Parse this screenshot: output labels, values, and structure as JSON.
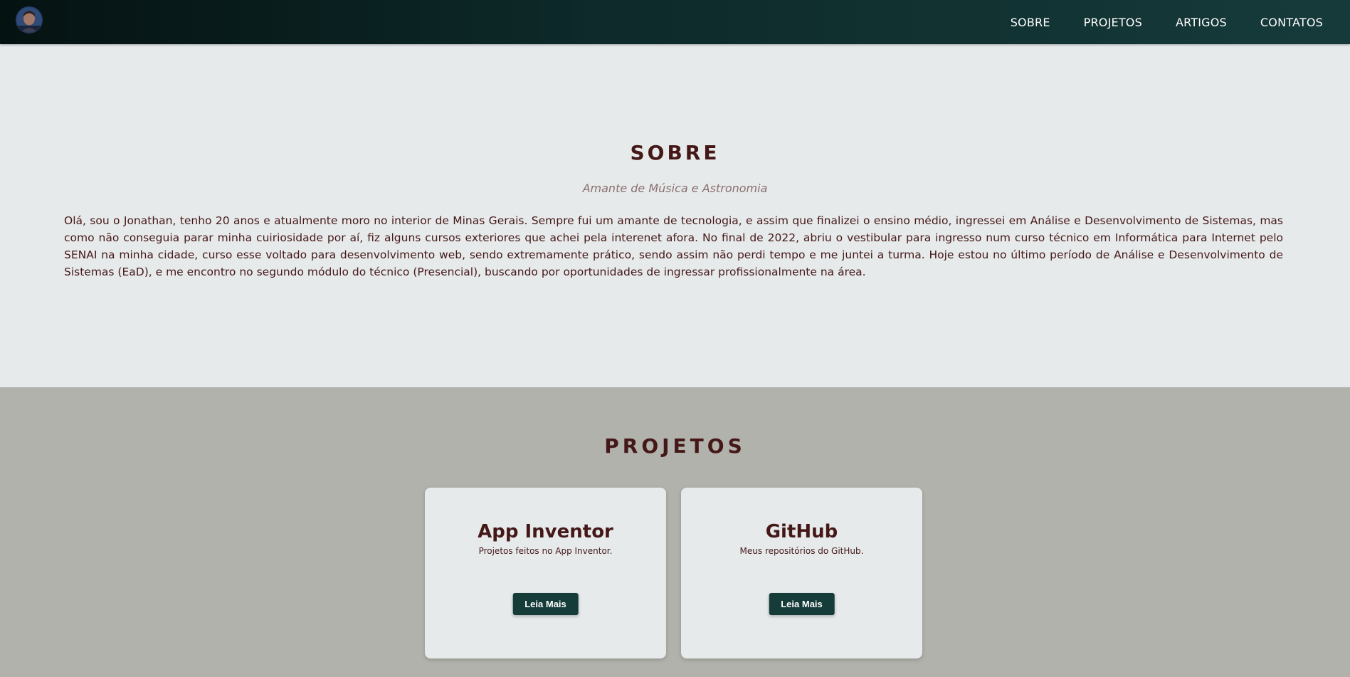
{
  "header": {
    "nav": [
      "SOBRE",
      "PROJETOS",
      "ARTIGOS",
      "CONTATOS"
    ]
  },
  "about": {
    "title": "SOBRE",
    "subtitle": "Amante de Música e Astronomia",
    "text": "Olá, sou o Jonathan, tenho 20 anos e atualmente moro no interior de Minas Gerais. Sempre fui um amante de tecnologia, e assim que finalizei o ensino médio, ingressei em Análise e Desenvolvimento de Sistemas, mas como não conseguia parar minha cuiriosidade por aí, fiz alguns cursos exteriores que achei pela interenet afora. No final de 2022, abriu o vestibular para ingresso num curso técnico em Informática para Internet pelo SENAI na minha cidade, curso esse voltado para desenvolvimento web, sendo extremamente prático, sendo assim não perdi tempo e me juntei a turma. Hoje estou no último período de Análise e Desenvolvimento de Sistemas (EaD), e me encontro no segundo módulo do técnico (Presencial), buscando por oportunidades de ingressar profissionalmente na área."
  },
  "projects": {
    "title": "PROJETOS",
    "cards": [
      {
        "title": "App Inventor",
        "description": "Projetos feitos no App Inventor.",
        "button": "Leia Mais"
      },
      {
        "title": "GitHub",
        "description": "Meus repositórios do GitHub.",
        "button": "Leia Mais"
      }
    ]
  }
}
